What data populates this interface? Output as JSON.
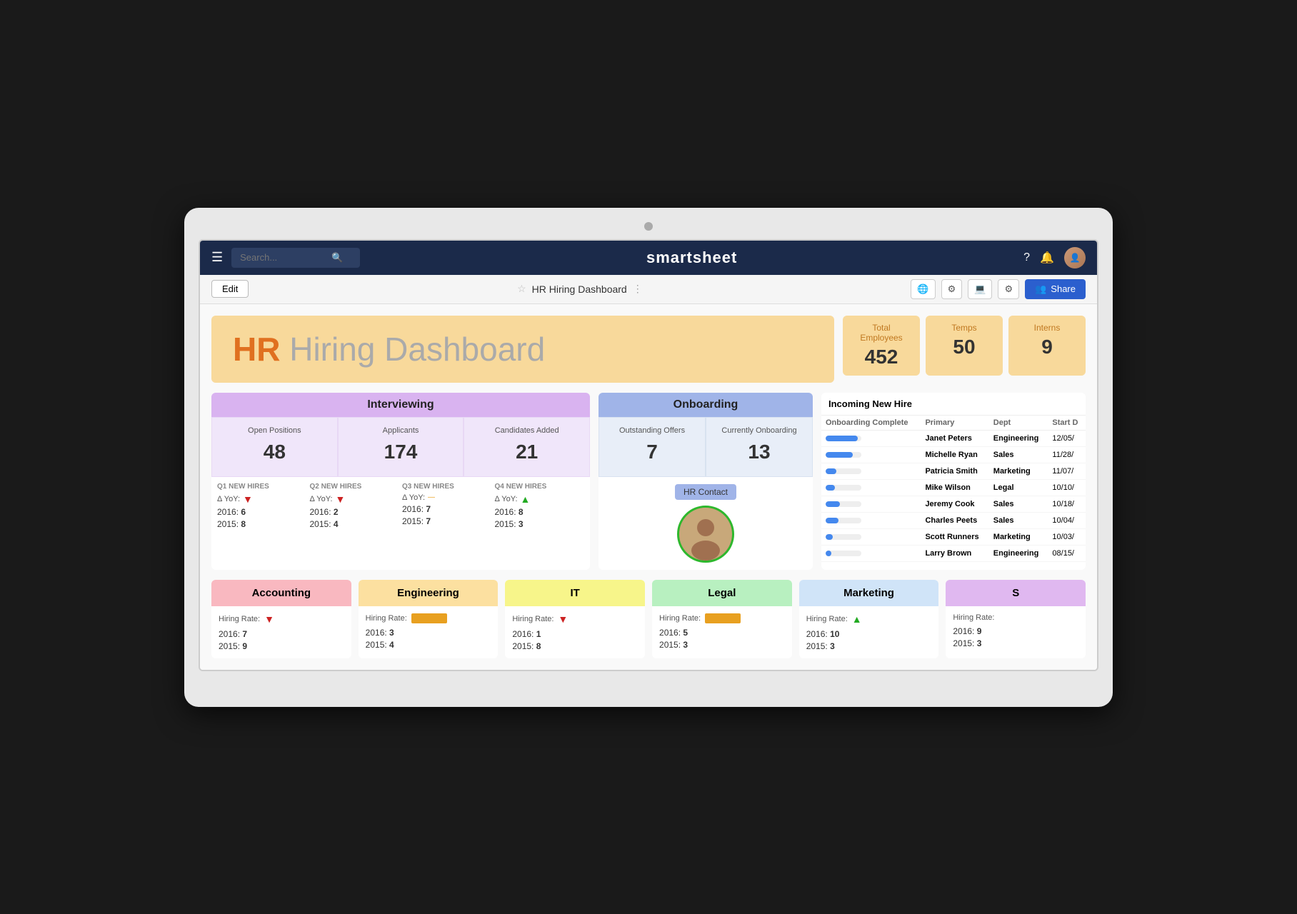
{
  "monitor": {
    "camera_label": "camera"
  },
  "topnav": {
    "hamburger": "☰",
    "search_placeholder": "Search...",
    "logo": "smartsheet",
    "logo_bold": "smart",
    "icons": {
      "help": "?",
      "bell": "🔔",
      "avatar_initials": "👤"
    }
  },
  "toolbar": {
    "edit_label": "Edit",
    "star": "☆",
    "title": "HR Hiring Dashboard",
    "menu": "⋮",
    "icons": [
      "🌐",
      "⚙",
      "💻",
      "⚙"
    ],
    "share_label": "Share"
  },
  "hero": {
    "title_bold": "HR",
    "title_rest": " Hiring Dashboard",
    "stats": [
      {
        "label": "Total Employees",
        "value": "452"
      },
      {
        "label": "Temps",
        "value": "50"
      },
      {
        "label": "Interns",
        "value": "9"
      }
    ]
  },
  "interviewing": {
    "header": "Interviewing",
    "metrics": [
      {
        "label": "Open Positions",
        "value": "48"
      },
      {
        "label": "Applicants",
        "value": "174"
      },
      {
        "label": "Candidates Added",
        "value": "21"
      }
    ],
    "quarters": [
      {
        "label": "Q1 NEW HIRES",
        "yoy": "down",
        "year1_label": "2016:",
        "year1_val": "6",
        "year2_label": "2015:",
        "year2_val": "8"
      },
      {
        "label": "Q2 NEW HIRES",
        "yoy": "down",
        "year1_label": "2016:",
        "year1_val": "2",
        "year2_label": "2015:",
        "year2_val": "4"
      },
      {
        "label": "Q3 NEW HIRES",
        "yoy": "flat",
        "year1_label": "2016:",
        "year1_val": "7",
        "year2_label": "2015:",
        "year2_val": "7"
      },
      {
        "label": "Q4 NEW HIRES",
        "yoy": "up",
        "year1_label": "2016:",
        "year1_val": "8",
        "year2_label": "2015:",
        "year2_val": "3"
      }
    ]
  },
  "onboarding": {
    "header": "Onboarding",
    "metrics": [
      {
        "label": "Outstanding Offers",
        "value": "7"
      },
      {
        "label": "Currently Onboarding",
        "value": "13"
      }
    ],
    "hr_contact_label": "HR Contact"
  },
  "new_hires": {
    "title": "Incoming New Hire",
    "columns": [
      "Onboarding Complete",
      "Primary",
      "Dept",
      "Start D"
    ],
    "rows": [
      {
        "progress": 90,
        "name": "Janet Peters",
        "dept": "Engineering",
        "start": "12/05/"
      },
      {
        "progress": 75,
        "name": "Michelle Ryan",
        "dept": "Sales",
        "start": "11/28/"
      },
      {
        "progress": 30,
        "name": "Patricia Smith",
        "dept": "Marketing",
        "start": "11/07/"
      },
      {
        "progress": 25,
        "name": "Mike Wilson",
        "dept": "Legal",
        "start": "10/10/"
      },
      {
        "progress": 40,
        "name": "Jeremy Cook",
        "dept": "Sales",
        "start": "10/18/"
      },
      {
        "progress": 35,
        "name": "Charles Peets",
        "dept": "Sales",
        "start": "10/04/"
      },
      {
        "progress": 20,
        "name": "Scott Runners",
        "dept": "Marketing",
        "start": "10/03/"
      },
      {
        "progress": 15,
        "name": "Larry Brown",
        "dept": "Engineering",
        "start": "08/15/"
      }
    ]
  },
  "departments": [
    {
      "name": "Accounting",
      "class": "dept-accounting",
      "hiring_rate_type": "down",
      "year1_label": "2016:",
      "year1_val": "7",
      "year2_label": "2015:",
      "year2_val": "9"
    },
    {
      "name": "Engineering",
      "class": "dept-engineering",
      "hiring_rate_type": "bar",
      "year1_label": "2016:",
      "year1_val": "3",
      "year2_label": "2015:",
      "year2_val": "4"
    },
    {
      "name": "IT",
      "class": "dept-it",
      "hiring_rate_type": "down",
      "year1_label": "2016:",
      "year1_val": "1",
      "year2_label": "2015:",
      "year2_val": "8"
    },
    {
      "name": "Legal",
      "class": "dept-legal",
      "hiring_rate_type": "bar",
      "year1_label": "2016:",
      "year1_val": "5",
      "year2_label": "2015:",
      "year2_val": "3"
    },
    {
      "name": "Marketing",
      "class": "dept-marketing",
      "hiring_rate_type": "up",
      "year1_label": "2016:",
      "year1_val": "10",
      "year2_label": "2015:",
      "year2_val": "3"
    },
    {
      "name": "S",
      "class": "dept-s",
      "hiring_rate_type": "none",
      "year1_label": "2016:",
      "year1_val": "9",
      "year2_label": "2015:",
      "year2_val": "3"
    }
  ],
  "yoy_label": "Δ YoY:",
  "arrow_down": "▼",
  "arrow_up": "▲",
  "arrow_flat": "—"
}
